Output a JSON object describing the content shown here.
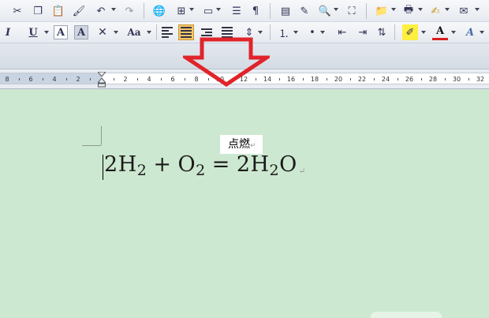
{
  "ruler": {
    "labels": [
      "8",
      "6",
      "4",
      "2",
      "2",
      "4",
      "6",
      "8",
      "10",
      "12",
      "14",
      "16",
      "18",
      "20",
      "22",
      "24",
      "26",
      "28",
      "30",
      "32"
    ]
  },
  "document": {
    "label_text": "点燃",
    "equation": {
      "coef1": "2",
      "h": "H",
      "sub1": "2",
      "plus": "+",
      "o": "O",
      "sub2": "2",
      "equals": "=",
      "coef2": "2",
      "h2": "H",
      "sub3": "2",
      "o2": "O"
    },
    "paragraph_mark": "↵"
  },
  "colors": {
    "document_background": "#cde8d1",
    "arrow": "#e0242a",
    "highlight_active": "#f5c76b"
  }
}
